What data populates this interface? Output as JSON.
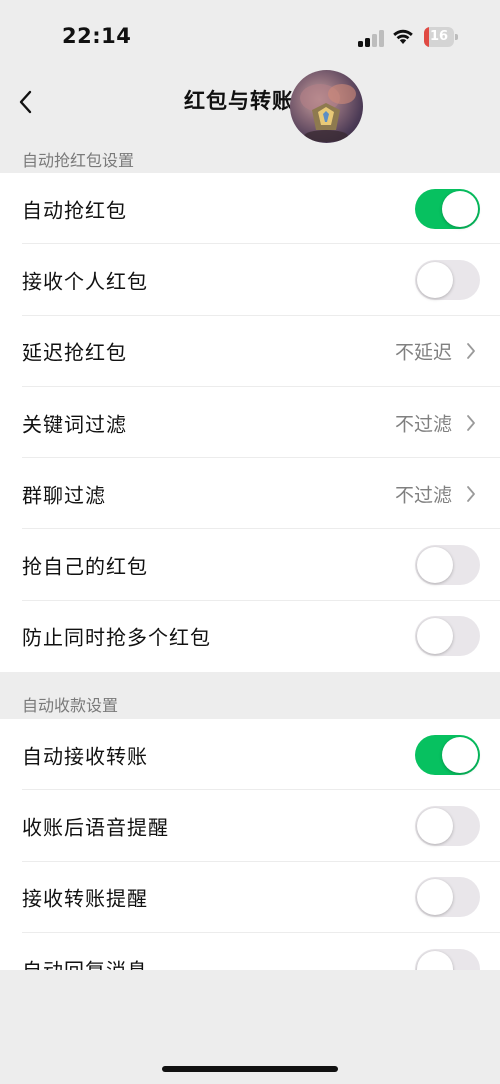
{
  "status_bar": {
    "time": "22:14",
    "battery_level": "16",
    "battery_color": "#e04a43"
  },
  "nav": {
    "title": "红包与转账设",
    "back_icon": "chevron-left-icon"
  },
  "sections": [
    {
      "header": "自动抢红包设置",
      "rows": [
        {
          "label": "自动抢红包",
          "type": "toggle",
          "on": true
        },
        {
          "label": "接收个人红包",
          "type": "toggle",
          "on": false
        },
        {
          "label": "延迟抢红包",
          "type": "value",
          "value": "不延迟"
        },
        {
          "label": "关键词过滤",
          "type": "value",
          "value": "不过滤"
        },
        {
          "label": "群聊过滤",
          "type": "value",
          "value": "不过滤"
        },
        {
          "label": "抢自己的红包",
          "type": "toggle",
          "on": false
        },
        {
          "label": "防止同时抢多个红包",
          "type": "toggle",
          "on": false
        }
      ]
    },
    {
      "header": "自动收款设置",
      "rows": [
        {
          "label": "自动接收转账",
          "type": "toggle",
          "on": true
        },
        {
          "label": "收账后语音提醒",
          "type": "toggle",
          "on": false
        },
        {
          "label": "接收转账提醒",
          "type": "toggle",
          "on": false
        },
        {
          "label": "自动回复消息",
          "type": "toggle",
          "on": false
        }
      ]
    }
  ],
  "colors": {
    "toggle_on": "#07c160",
    "toggle_off": "#e9e6ea",
    "background": "#ededed"
  }
}
